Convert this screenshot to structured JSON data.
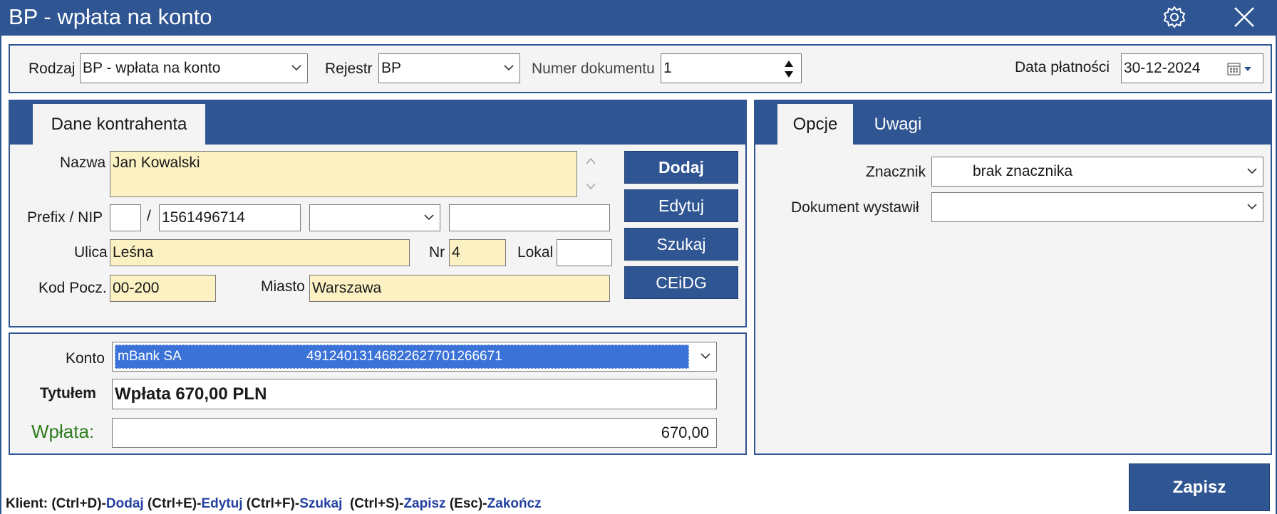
{
  "window": {
    "title": "BP - wpłata na konto",
    "icons": {
      "settings": "gear-icon",
      "close": "close-icon"
    }
  },
  "colors": {
    "accent": "#2f5592",
    "required_field": "#fbf1c3",
    "amount_label": "#2e7d1e",
    "selection": "#3a72d8"
  },
  "header": {
    "rodzaj_label": "Rodzaj",
    "rodzaj_value": "BP - wpłata na konto",
    "rejestr_label": "Rejestr",
    "rejestr_value": "BP",
    "numer_label": "Numer dokumentu",
    "numer_value": "1",
    "data_label": "Data płatności",
    "data_value": "30-12-2024"
  },
  "contractor": {
    "tab_label": "Dane kontrahenta",
    "nazwa_label": "Nazwa",
    "nazwa_value": "Jan Kowalski",
    "prefix_label": "Prefix / NIP",
    "prefix_value": "",
    "slash": "/",
    "nip_value": "1561496714",
    "nip_type_value": "",
    "extra_value": "",
    "ulica_label": "Ulica",
    "ulica_value": "Leśna",
    "nr_label": "Nr",
    "nr_value": "4",
    "lokal_label": "Lokal",
    "lokal_value": "",
    "kod_label": "Kod Pocz.",
    "kod_value": "00-200",
    "miasto_label": "Miasto",
    "miasto_value": "Warszawa",
    "buttons": {
      "dodaj": "Dodaj",
      "edytuj": "Edytuj",
      "szukaj": "Szukaj",
      "ceidg": "CEiDG"
    }
  },
  "payment": {
    "konto_label": "Konto",
    "konto_bank": "mBank SA",
    "konto_number": "49124013146822627701266671",
    "tytul_label": "Tytułem",
    "tytul_value": "Wpłata 670,00 PLN",
    "wplata_label": "Wpłata:",
    "wplata_value": "670,00"
  },
  "options": {
    "tabs": [
      {
        "label": "Opcje"
      },
      {
        "label": "Uwagi"
      }
    ],
    "znacznik_label": "Znacznik",
    "znacznik_value": "brak znacznika",
    "wystawil_label": "Dokument wystawił",
    "wystawil_value": ""
  },
  "footer": {
    "save_label": "Zapisz",
    "hint_prefix": "Klient: ",
    "hints": [
      {
        "key": "(Ctrl+D)-",
        "action": "Dodaj"
      },
      {
        "key": " (Ctrl+E)-",
        "action": "Edytuj"
      },
      {
        "key": " (Ctrl+F)-",
        "action": "Szukaj"
      },
      {
        "key": "  (Ctrl+S)-",
        "action": "Zapisz"
      },
      {
        "key": " (Esc)-",
        "action": "Zakończ"
      }
    ]
  }
}
